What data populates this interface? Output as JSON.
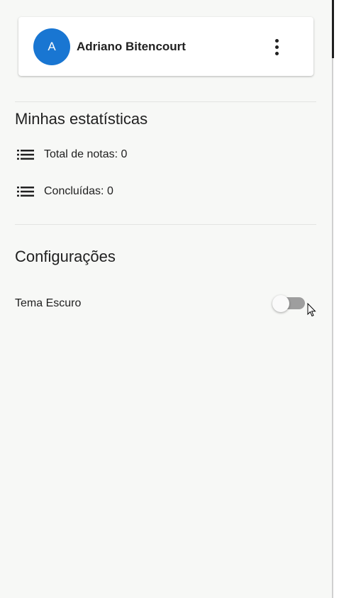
{
  "profile": {
    "avatar_initial": "A",
    "name": "Adriano Bitencourt",
    "menu_icon": "more-vert-icon"
  },
  "stats": {
    "title": "Minhas estatísticas",
    "items": [
      {
        "icon": "list-icon",
        "label": "Total de notas: 0"
      },
      {
        "icon": "list-icon",
        "label": "Concluídas: 0"
      }
    ]
  },
  "settings": {
    "title": "Configurações",
    "dark_theme": {
      "label": "Tema Escuro",
      "enabled": false
    }
  },
  "colors": {
    "avatar": "#1976d2",
    "drawer_background": "#f7f8f6",
    "switch_track_off": "#9e9e9e"
  }
}
